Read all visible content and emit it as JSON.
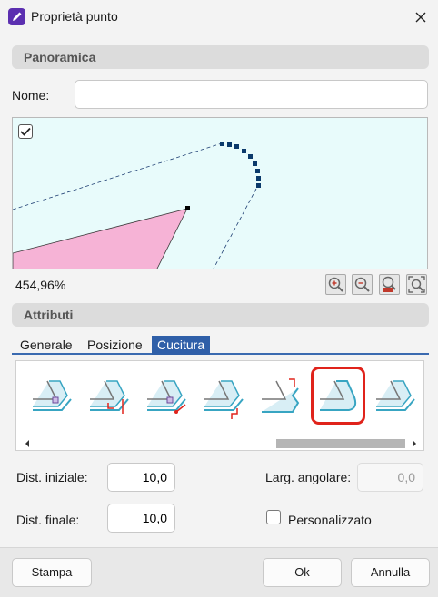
{
  "window": {
    "title": "Proprietà punto"
  },
  "sections": {
    "panoramica": "Panoramica",
    "attributi": "Attributi"
  },
  "name_field": {
    "label": "Nome:",
    "value": ""
  },
  "preview": {
    "zoom_percent": "454,96%",
    "checkbox_checked": true,
    "fill_color": "#f6b3d6",
    "point_color": "#0b3a6b"
  },
  "tabs": [
    {
      "label": "Generale"
    },
    {
      "label": "Posizione"
    },
    {
      "label": "Cucitura"
    }
  ],
  "stitch_types": {
    "selected_index": 5,
    "items": [
      "stitch-icon",
      "stitch-icon",
      "stitch-icon",
      "stitch-icon",
      "stitch-icon",
      "stitch-icon",
      "stitch-icon"
    ]
  },
  "fields": {
    "dist_iniziale": {
      "label": "Dist. iniziale:",
      "value": "10,0"
    },
    "dist_finale": {
      "label": "Dist. finale:",
      "value": "10,0"
    },
    "larg_angolare": {
      "label": "Larg. angolare:",
      "value": "0,0"
    },
    "personalizzato": {
      "label": "Personalizzato",
      "checked": false
    }
  },
  "buttons": {
    "stampa": "Stampa",
    "ok": "Ok",
    "annulla": "Annulla"
  },
  "colors": {
    "accent": "#2f5fa8",
    "selection": "#e0231b"
  }
}
